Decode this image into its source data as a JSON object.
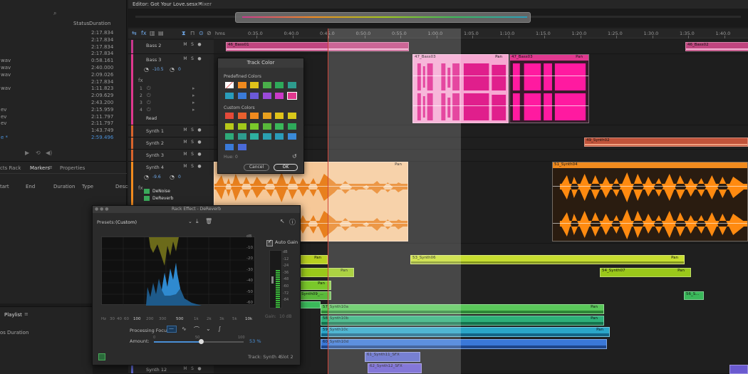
{
  "files": {
    "headers": {
      "status": "Status",
      "duration": "Duration"
    },
    "rows": [
      {
        "name": "",
        "duration": "2:17.834"
      },
      {
        "name": "",
        "duration": "2:17.834"
      },
      {
        "name": "",
        "duration": "2:17.834"
      },
      {
        "name": "",
        "duration": "2:17.834"
      },
      {
        "name": "wav",
        "duration": "0:58.161"
      },
      {
        "name": "wav",
        "duration": "2:40.000"
      },
      {
        "name": "wav",
        "duration": "2:09.026"
      },
      {
        "name": "",
        "duration": "2:17.834"
      },
      {
        "name": "wav",
        "duration": "1:11.823"
      },
      {
        "name": "",
        "duration": "2:09.629"
      },
      {
        "name": "",
        "duration": "2:43.200"
      },
      {
        "name": "ev",
        "duration": "2:15.959"
      },
      {
        "name": "ev",
        "duration": "2:11.797"
      },
      {
        "name": "ev",
        "duration": "2:11.797"
      },
      {
        "name": "",
        "duration": "1:43.749"
      },
      {
        "name": "e *",
        "duration": "2:59.496",
        "selected": true
      }
    ]
  },
  "markers": {
    "tabs": [
      "cts Rack",
      "Markers",
      "Properties"
    ],
    "columns": [
      "tart",
      "End",
      "Duration",
      "Type",
      "Descr"
    ]
  },
  "playlist": {
    "tab": "Playlist",
    "columns": [
      "os",
      "Duration"
    ]
  },
  "editor": {
    "tab": "Editor: Got Your Love.sesx *",
    "tab2": "Mixer",
    "ruler_unit": "hms",
    "ruler": [
      "0:35.0",
      "0:40.0",
      "0:45.0",
      "0:50.0",
      "0:55.0",
      "1:00.0",
      "1:05.0",
      "1:10.0",
      "1:15.0",
      "1:20.0",
      "1:25.0",
      "1:30.0",
      "1:35.0",
      "1:40.0"
    ]
  },
  "tracks": [
    {
      "name": "Bass 2",
      "color": "#c9378e"
    },
    {
      "name": "Bass 3",
      "color": "#e0388f",
      "vol": "-10.5",
      "pan": "0",
      "mode": "Read",
      "slots": [
        "1",
        "2",
        "3",
        "4"
      ]
    },
    {
      "name": "Synth 1",
      "color": "#d8642c"
    },
    {
      "name": "Synth 2",
      "color": "#d8642c"
    },
    {
      "name": "Synth 3",
      "color": "#d8642c"
    },
    {
      "name": "Synth 4",
      "color": "#f08a1e",
      "vol": "-9.6",
      "pan": "0",
      "fx": [
        "DeNoise",
        "DeReverb"
      ]
    },
    {
      "name": "Synth 12",
      "color": "#5a64c8"
    }
  ],
  "clips": {
    "bass01": "46_Bass01",
    "bass02": "46_Bass02",
    "bass03a": "47_Bass03",
    "bass03b": "47_Bass03",
    "synth02": "49_Synth02",
    "synth04": "51_Synth04",
    "synth06": "53_Synth06",
    "synth07": "54_Synth07",
    "synth09": "Synth09_...",
    "s5": "56_S...",
    "synth10a": "57_Synth10a",
    "synth10b": "58_Synth10b",
    "synth10c": "59_Synth10c",
    "synth10d": "60_Synth10d",
    "sfx": "61_Synth11_SFX",
    "sfx2": "62_Synth12_SFX",
    "pan": "Pan"
  },
  "track_color": {
    "title": "Track Color",
    "predefined_label": "Predefined Colors",
    "custom_label": "Custom Colors",
    "hue_label": "Hue:",
    "hue_value": "0",
    "cancel": "Cancel",
    "ok": "OK",
    "predefined": [
      "#e34a3a",
      "#f08a1e",
      "#e0c21a",
      "#4ab04a",
      "#2eaa5a",
      "#2e9c8e",
      "#2a9cba",
      "#3a7ad8",
      "#6b5ad8",
      "#9a4ad8",
      "#c93ac8",
      "#e0388f"
    ],
    "custom": [
      "#e34a3a",
      "#e8602e",
      "#f08a1e",
      "#e8a01e",
      "#e0c21a",
      "#d8c81a",
      "#b8c81a",
      "#a0c81a",
      "#7ac82a",
      "#58b83a",
      "#3ab85a",
      "#2eaa5a",
      "#2eaa7a",
      "#2e9c8e",
      "#2eb0a0",
      "#2aa0b0",
      "#2a9cba",
      "#3a8ad8",
      "#3a7ad8",
      "#4a6ad8"
    ]
  },
  "rack": {
    "title": "Rack Effect - DeReverb",
    "presets_label": "Presets:",
    "preset_value": "(Custom)",
    "auto_gain": "Auto Gain",
    "db_scale": [
      "dB",
      "-10",
      "-20",
      "-30",
      "-40",
      "-50",
      "-60"
    ],
    "meter_scale": [
      "dB",
      "-12",
      "-24",
      "-36",
      "-48",
      "-60",
      "-72",
      "-84"
    ],
    "gain_label": "Gain:",
    "gain_value": "10 dB",
    "hz_scale": [
      "Hz",
      "30",
      "40",
      "60",
      "100",
      "200",
      "300",
      "500",
      "1k",
      "2k",
      "3k",
      "5k",
      "10k"
    ],
    "processing_focus": "Processing Focus:",
    "amount_label": "Amount:",
    "amount_min": "0",
    "amount_mid": "50",
    "amount_max": "100",
    "amount_value": "53 %",
    "amount_fraction": 0.53,
    "track": "Track: Synth 4",
    "slot": "Slot 2"
  }
}
